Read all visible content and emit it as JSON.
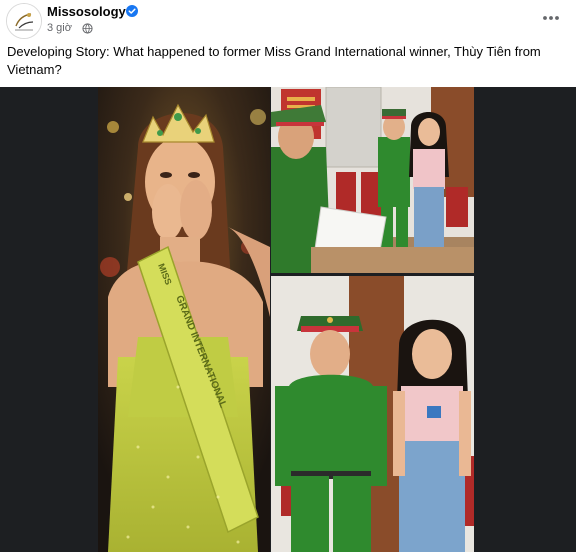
{
  "post": {
    "page_name": "Missosology",
    "timestamp": "3 giờ",
    "privacy_icon": "globe-icon",
    "verified_icon": "verified-badge-icon",
    "more_icon": "more-horizontal-icon",
    "caption": "Developing Story: What happened to former Miss Grand International winner, Thùy Tiên from Vietnam?"
  },
  "image": {
    "sash_text": "GRAND INTERNATIONAL",
    "sash_prefix": "MISS",
    "colors": {
      "media_bg": "#1d1f22",
      "sash": "#c8d64a",
      "dress": "#b7c43a",
      "uniform": "#2f8a2e",
      "cap": "#3a6b34",
      "cap_band": "#c8343b",
      "wall": "#e8e4de",
      "door": "#8a4c2a"
    }
  }
}
